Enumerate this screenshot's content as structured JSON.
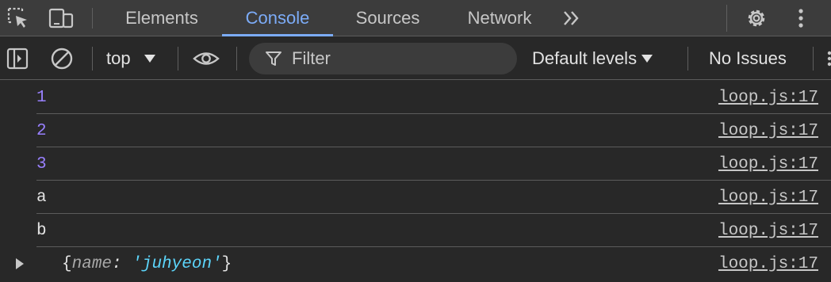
{
  "tabs": {
    "items": [
      "Elements",
      "Console",
      "Sources",
      "Network"
    ],
    "active": "Console",
    "more_label": "»"
  },
  "toolbar": {
    "context": "top",
    "filter_placeholder": "Filter",
    "levels": "Default levels",
    "issues": "No Issues"
  },
  "messages": [
    {
      "text": "1",
      "kind": "number",
      "source": "loop.js:17"
    },
    {
      "text": "2",
      "kind": "number",
      "source": "loop.js:17"
    },
    {
      "text": "3",
      "kind": "number",
      "source": "loop.js:17"
    },
    {
      "text": "a",
      "kind": "string",
      "source": "loop.js:17"
    },
    {
      "text": "b",
      "kind": "string",
      "source": "loop.js:17"
    },
    {
      "kind": "object",
      "open": "{",
      "key": "name",
      "colon": ": ",
      "value": "'juhyeon'",
      "close": "}",
      "source": "loop.js:17"
    }
  ],
  "icons": {
    "inspect": "inspect-element-icon",
    "device": "device-toolbar-icon",
    "sidebar": "show-sidebar-icon",
    "clear": "clear-console-icon",
    "eye": "live-expression-icon",
    "filter": "filter-icon",
    "settings": "settings-gear-icon",
    "menu": "more-options-icon"
  },
  "colors": {
    "accent": "#7cacf8",
    "number": "#9980ff",
    "string_value": "#5cd5fb"
  }
}
